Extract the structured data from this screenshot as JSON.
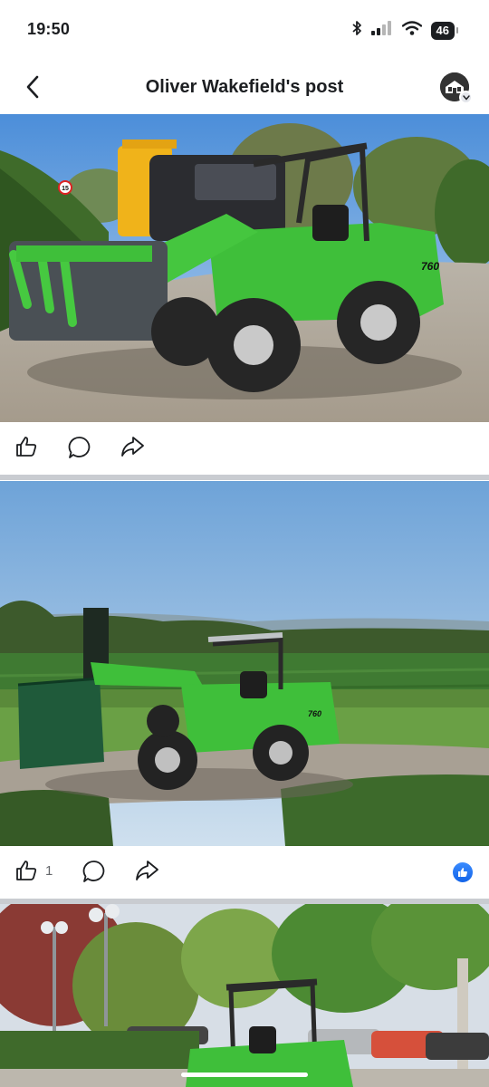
{
  "status": {
    "time": "19:50",
    "battery": "46"
  },
  "header": {
    "title": "Oliver Wakefield's post"
  },
  "posts": [
    {
      "image_alt": "Green compact loader with grapple parked on gravel driveway",
      "machine_model": "760",
      "sign_text": "15",
      "like_count": ""
    },
    {
      "image_alt": "Green compact loader with bag attachment overlooking fields",
      "machine_model": "760",
      "like_count": "1",
      "has_reaction": true
    },
    {
      "image_alt": "Green compact loader in a car park"
    }
  ],
  "colors": {
    "accent": "#1877f2",
    "machine_green": "#3fbf3a",
    "divider": "#c9ccd1"
  }
}
